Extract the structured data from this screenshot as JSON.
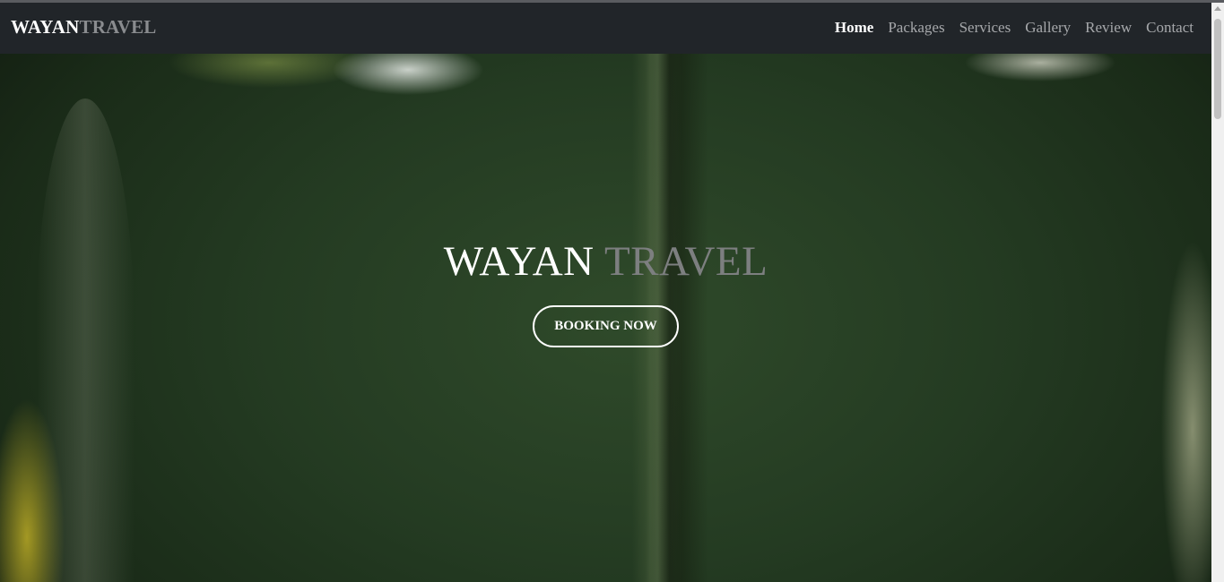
{
  "navbar": {
    "brand_part1": "WAYAN",
    "brand_part2": "TRAVEL",
    "links": [
      {
        "label": "Home",
        "active": true
      },
      {
        "label": "Packages",
        "active": false
      },
      {
        "label": "Services",
        "active": false
      },
      {
        "label": "Gallery",
        "active": false
      },
      {
        "label": "Review",
        "active": false
      },
      {
        "label": "Contact",
        "active": false
      }
    ]
  },
  "hero": {
    "title_part1": "WAYAN",
    "title_part2": "TRAVEL",
    "button_label": "BOOKING NOW"
  },
  "colors": {
    "navbar_bg": "#212529",
    "brand_primary": "#ffffff",
    "brand_secondary": "#8a8c8f",
    "hero_bg": "#243b22"
  },
  "icons": {
    "scroll_up": "scroll-up-arrow-icon"
  }
}
